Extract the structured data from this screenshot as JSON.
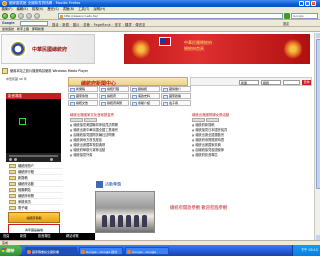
{
  "window": {
    "title": "國家圖書館 全國新書資訊網 - Mozilla Firefox"
  },
  "menubar": [
    "檔案(F)",
    "編輯(E)",
    "檢視(V)",
    "歷史(S)",
    "書籤(B)",
    "工具(T)",
    "說明(H)"
  ],
  "nav": {
    "url": "http://www.ncl.edu.tw/",
    "search_placeholder": "Google"
  },
  "google_bar": {
    "logo": "Google",
    "tools": "搜尋 · 新聞 · 圖片 · 書籤 · PageRank · 查字 · 翻譯 · 傳送至",
    "settings": "設定"
  },
  "bookmarks": [
    "最常造訪",
    "新手上路",
    "即時新聞"
  ],
  "banner": {
    "title": "中華民國總統府"
  },
  "red_banner": {
    "line1": "中華民國總統府",
    "line2": "總統府首頁"
  },
  "plugin_text": "使用本站之影片播放時請使用 Windows Media Player",
  "date_text": "中華民國 98 年",
  "video_header": "影音專區",
  "left_menu": [
    "總統府簡介",
    "總統府行程",
    "新聞稿",
    "總統府活動",
    "相關網站",
    "總統府導覽",
    "參觀資訊",
    "電子報"
  ],
  "left_banner": "總統府參觀",
  "left_banner2": "青年國是論壇",
  "mid_header": "總統府新聞中心",
  "search_bar": {
    "sel1": "新聞",
    "sel2": "標題",
    "go": "查詢"
  },
  "grid": [
    "新聞稿",
    "總統行程",
    "副總統",
    "國情簡介",
    "國家象徵",
    "總統府",
    "憲政史料",
    "國家政策",
    "總統文告",
    "總統府導覽",
    "參觀介紹",
    "電子報"
  ],
  "news_left": {
    "heading": "總統出席國家文化藝術基金會",
    "items": [
      "總統接見美國聯邦參議員訪問團",
      "總統出席中華民國全國工業總會",
      "副總統接見國際扶輪社訪問團",
      "總統與地方首長座談",
      "總統出席國軍校閱典禮",
      "總統府舉辦元宵節活動",
      "總統接見外賓"
    ]
  },
  "news_right": {
    "heading": "總統出席國際婦女節活動",
    "items": [
      "總統府新聞稿",
      "總統接見日本國會議員",
      "總統出席全國運動會",
      "總統府導覽開放時間",
      "總統出席國家慶典",
      "副總統接見各國使節",
      "總統府影音專區"
    ]
  },
  "section": {
    "title": "活動專題",
    "photo_title": "總統府開放參觀 歡迎蒞臨參觀"
  },
  "page_tabs": [
    "首頁",
    "新聞",
    "影音專區",
    "網站導覽"
  ],
  "status": "完成",
  "taskbar": {
    "start": "開始",
    "windows": [
      "國家圖書館全國新書",
      "Google - Google 搜尋",
      "Google - Google"
    ],
    "clock": "下午 09:15"
  }
}
